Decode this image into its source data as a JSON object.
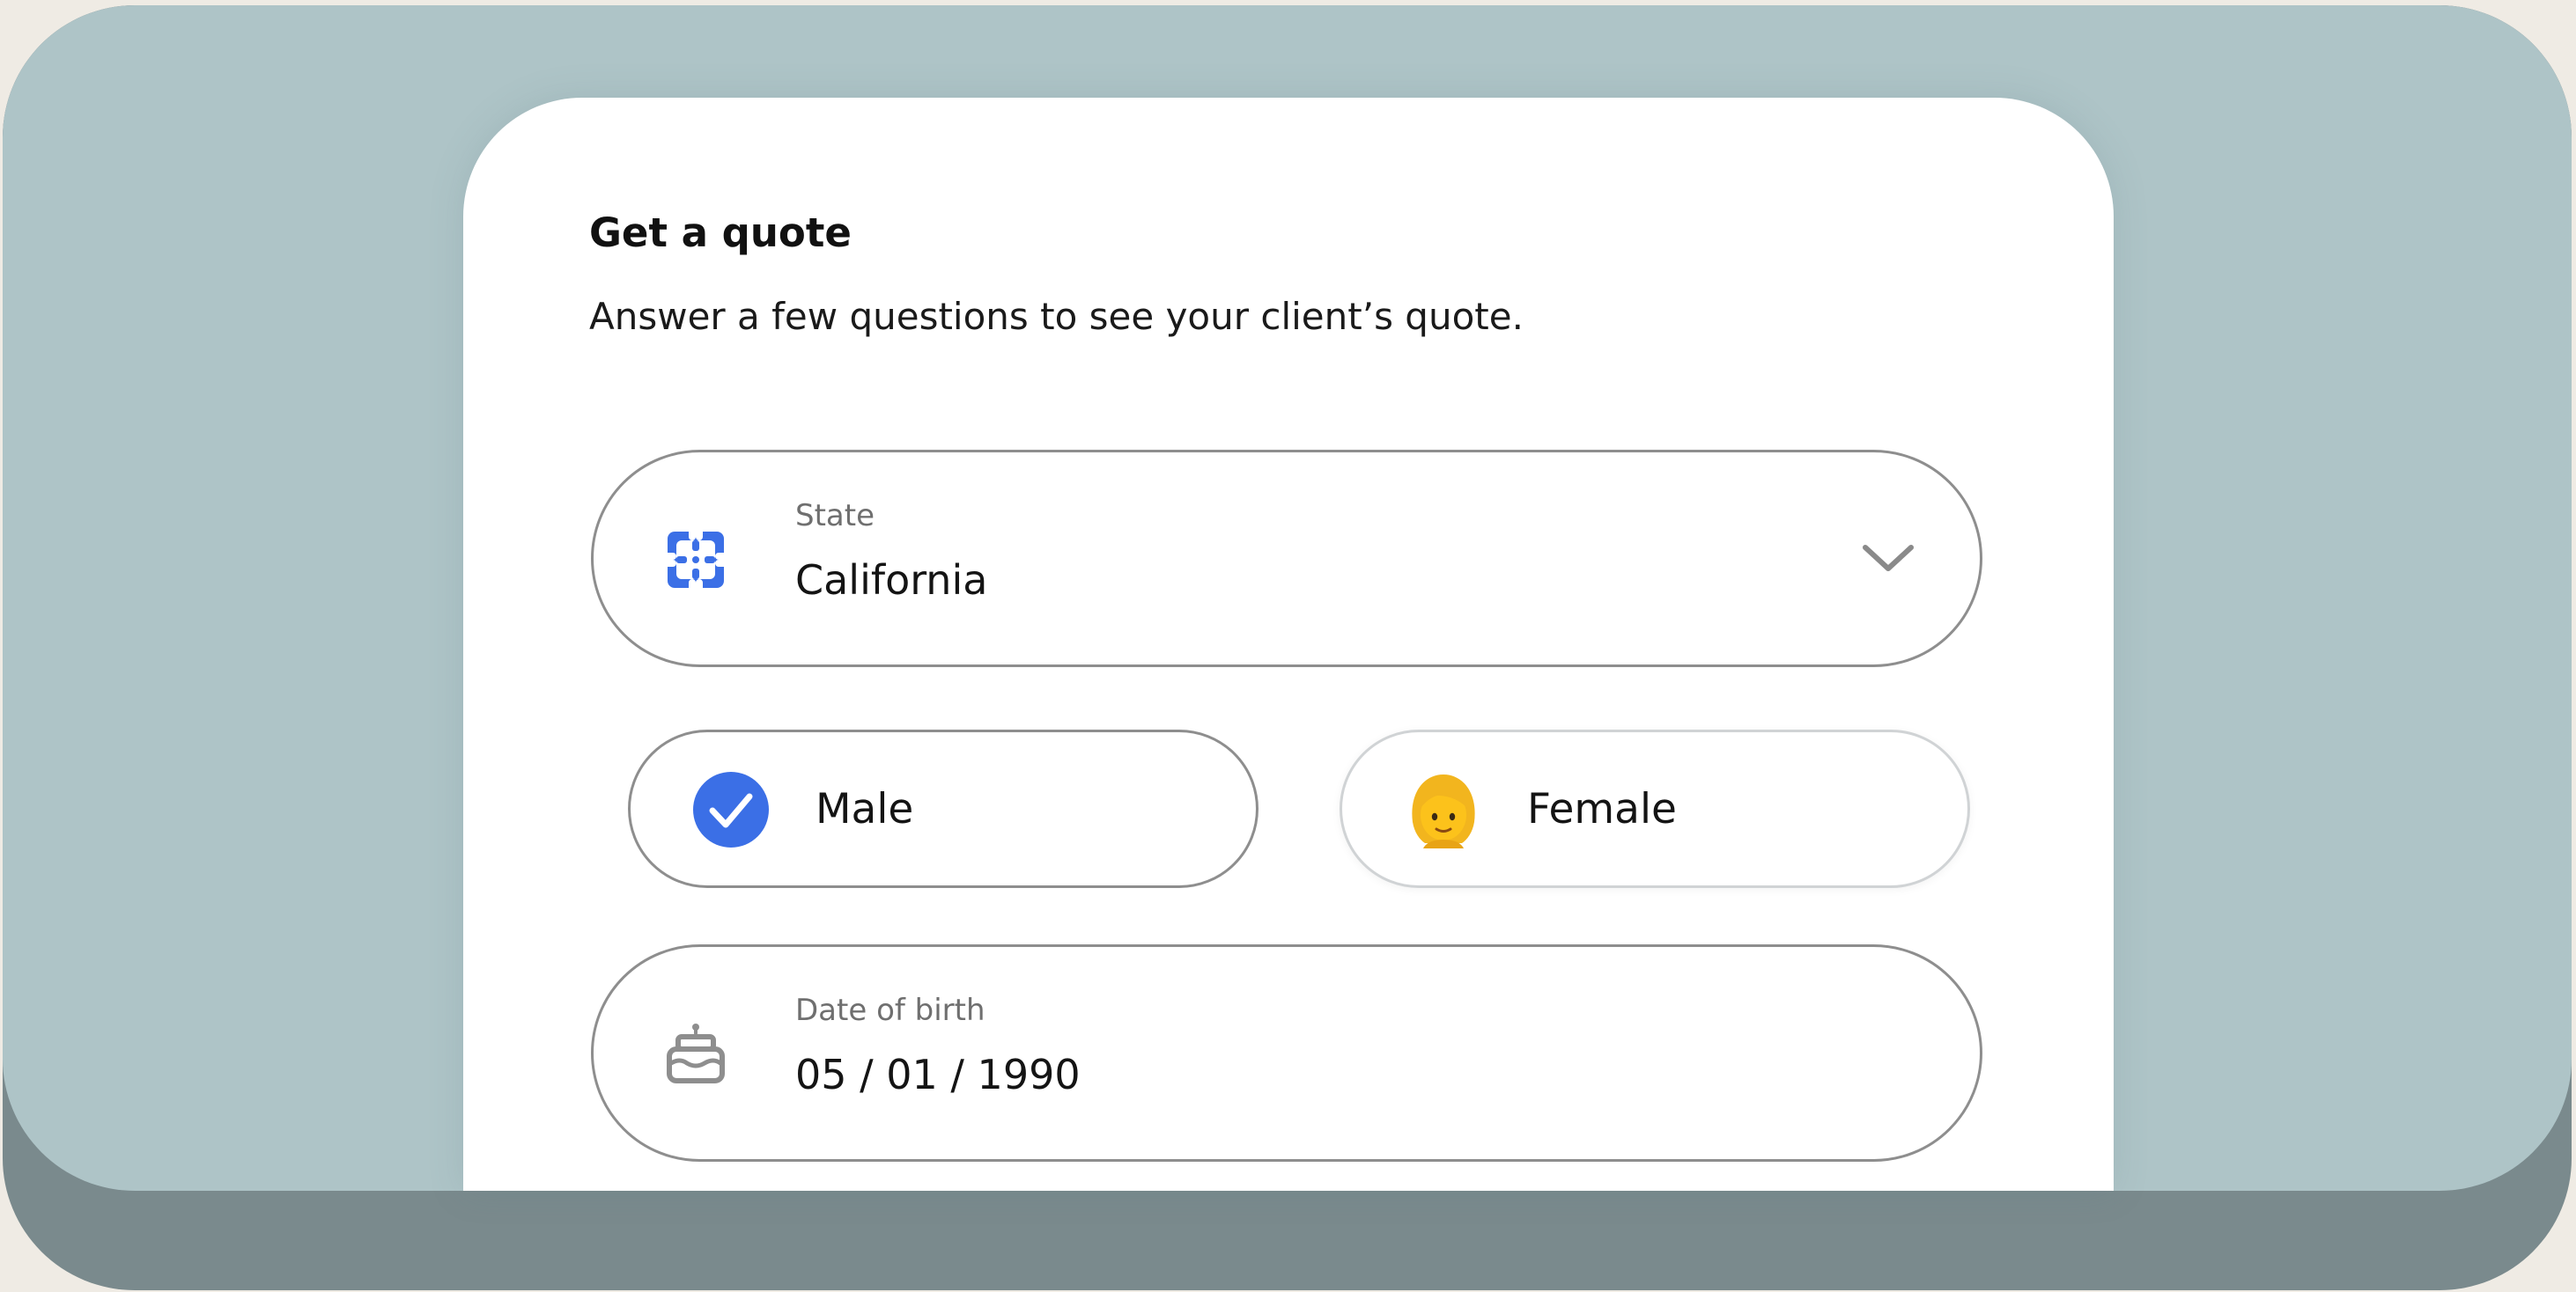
{
  "form": {
    "title": "Get a quote",
    "subtitle": "Answer a few questions to see your client’s quote."
  },
  "state_field": {
    "label": "State",
    "value": "California",
    "icon": "state-map-icon",
    "chevron_icon": "chevron-down-icon"
  },
  "gender": {
    "options": [
      {
        "label": "Male",
        "selected": true,
        "icon": "checkmark-icon"
      },
      {
        "label": "Female",
        "selected": false,
        "icon": "woman-emoji-icon"
      }
    ]
  },
  "dob_field": {
    "label": "Date of birth",
    "value": "05 / 01 / 1990",
    "icon": "birthday-cake-icon"
  },
  "colors": {
    "accent": "#3b6fe6",
    "border": "#8e8e8e",
    "background": "#aec4c7",
    "background_shadow": "#7a8a8d"
  }
}
